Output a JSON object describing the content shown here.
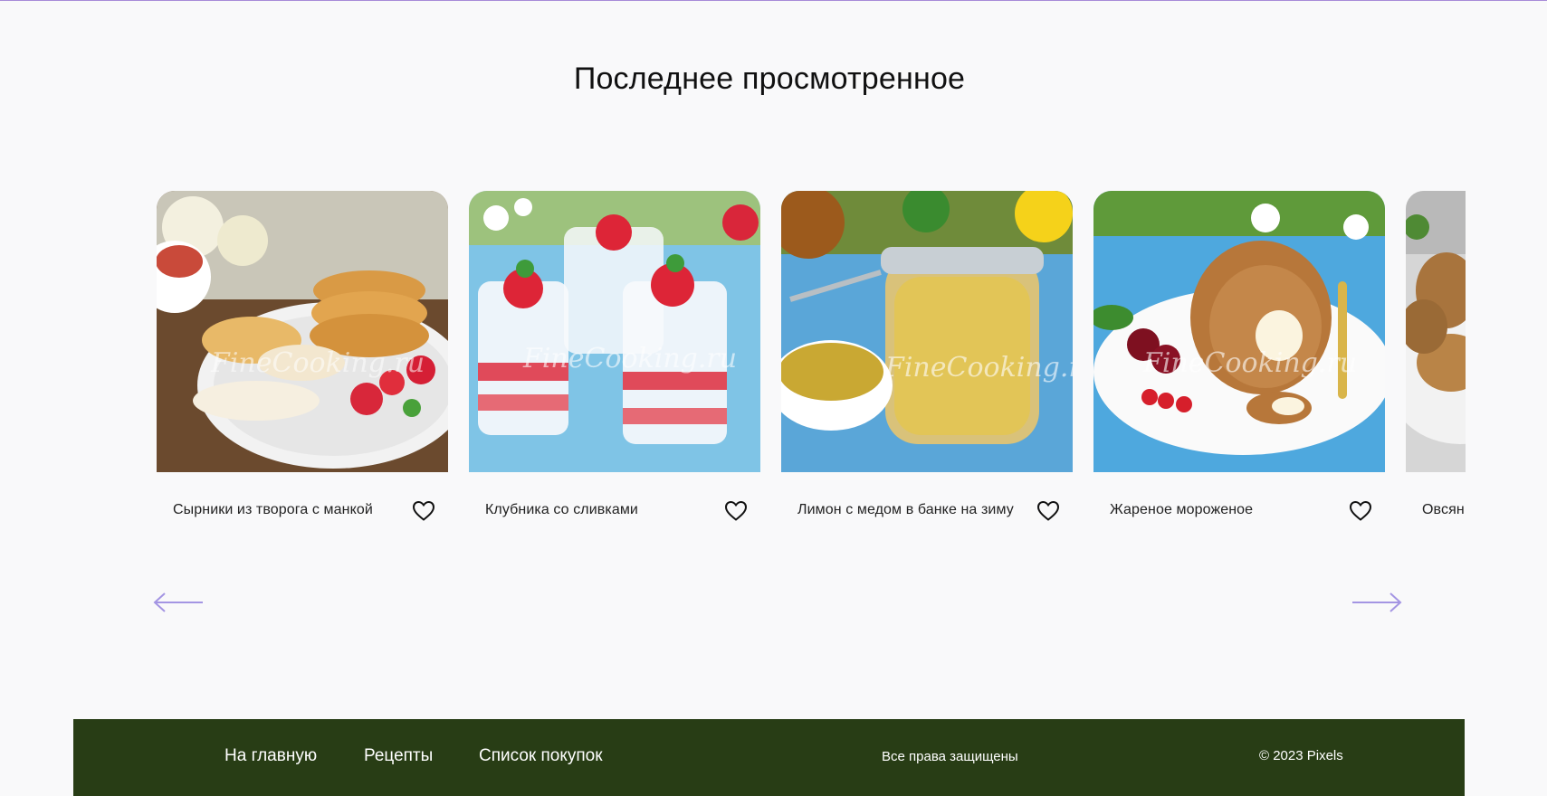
{
  "page": {
    "title": "Последнее просмотренное"
  },
  "carousel": {
    "items": [
      {
        "title": "Сырники из творога с манкой",
        "image": "syrniki-photo"
      },
      {
        "title": "Клубника со сливками",
        "image": "strawberry-cream-photo"
      },
      {
        "title": "Лимон с медом в банке на зиму",
        "image": "lemon-honey-jar-photo"
      },
      {
        "title": "Жареное мороженое",
        "image": "fried-ice-cream-photo"
      },
      {
        "title": "Овсян",
        "image": "oat-cutlets-photo"
      }
    ],
    "prev_icon": "arrow-left-icon",
    "next_icon": "arrow-right-icon",
    "favorite_icon": "heart-icon",
    "arrow_color": "#a495e3"
  },
  "footer": {
    "background": "#283d15",
    "nav": [
      {
        "label": "На главную"
      },
      {
        "label": "Рецепты"
      },
      {
        "label": "Список покупок"
      }
    ],
    "rights": "Все права защищены",
    "copyright": "© 2023 Pixels"
  }
}
